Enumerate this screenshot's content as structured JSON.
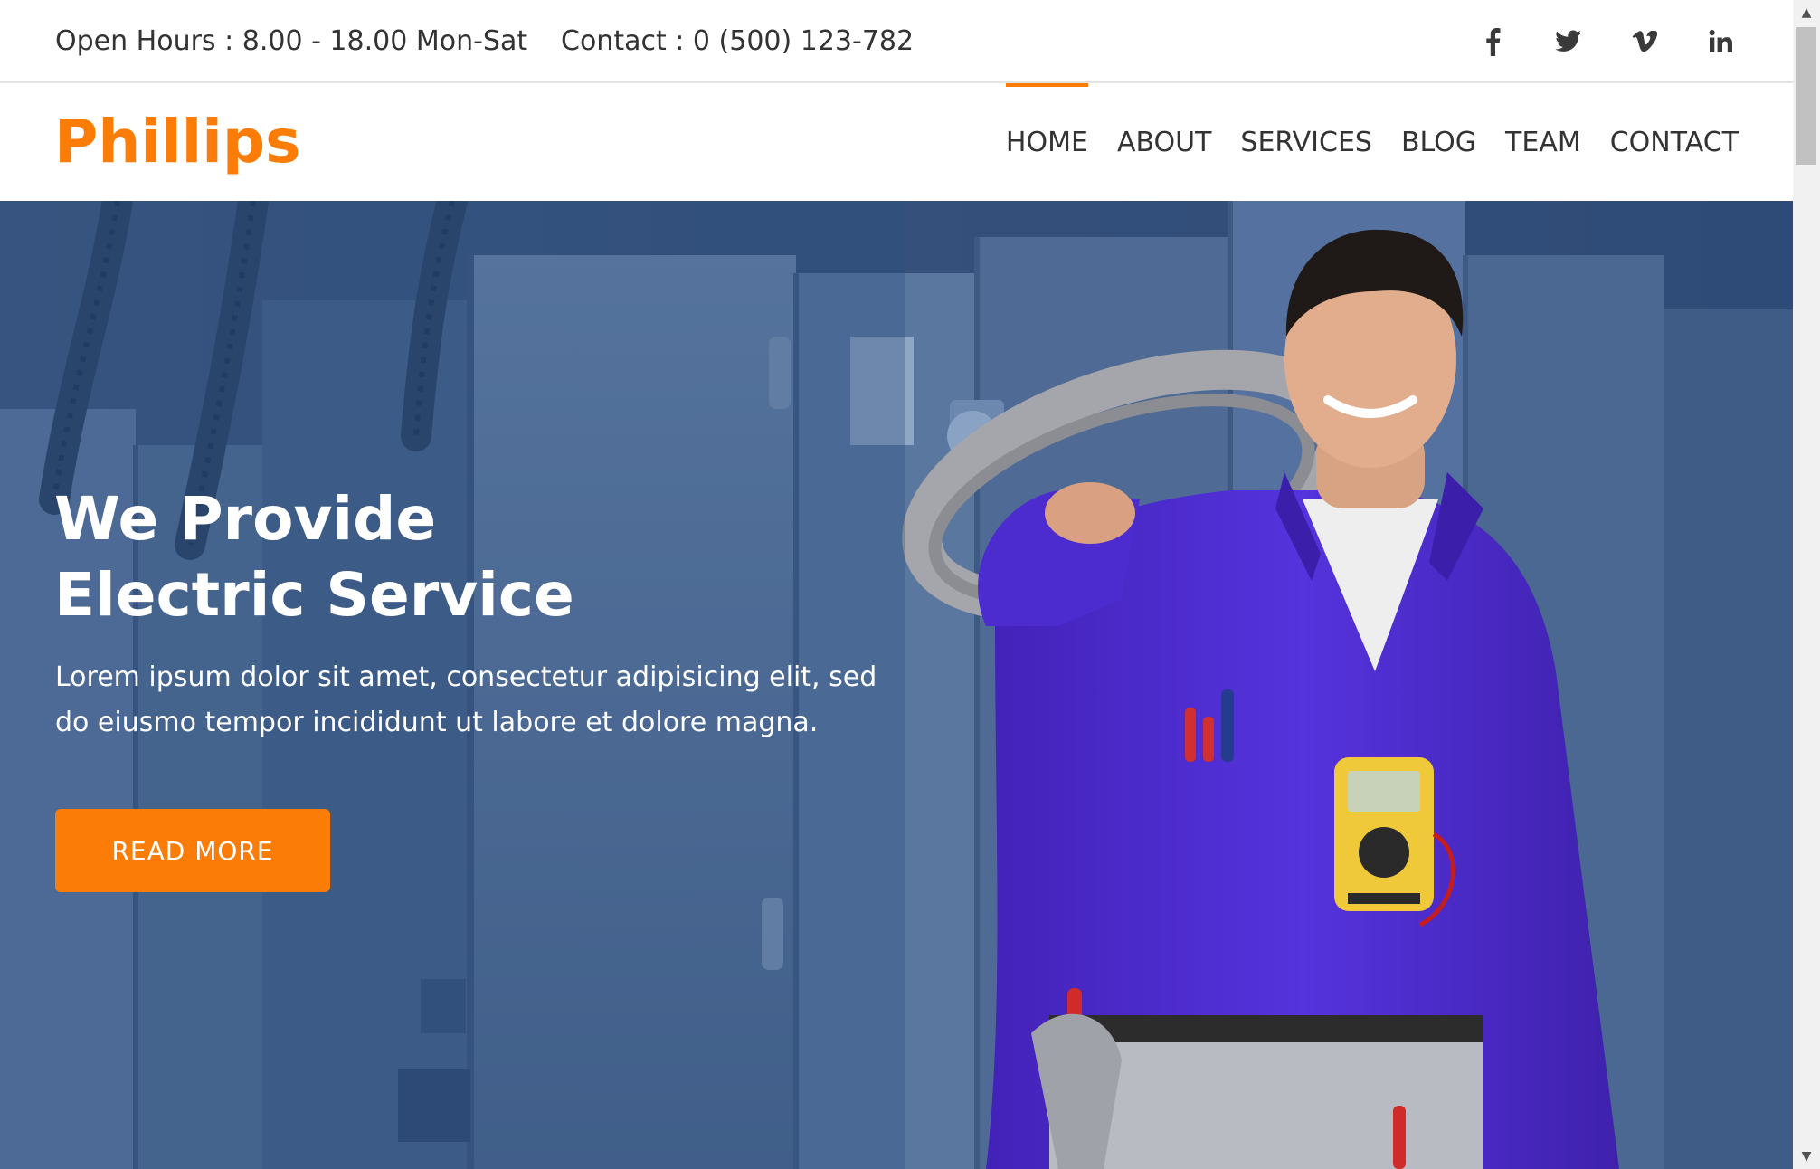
{
  "topbar": {
    "hours": "Open Hours : 8.00 - 18.00 Mon-Sat",
    "contact": "Contact : 0 (500) 123-782",
    "social": [
      "facebook-icon",
      "twitter-icon",
      "vimeo-icon",
      "linkedin-icon"
    ]
  },
  "brand": {
    "logo": "Phillips"
  },
  "nav": {
    "items": [
      {
        "label": "HOME",
        "active": true
      },
      {
        "label": "ABOUT",
        "active": false
      },
      {
        "label": "SERVICES",
        "active": false
      },
      {
        "label": "BLOG",
        "active": false
      },
      {
        "label": "TEAM",
        "active": false
      },
      {
        "label": "CONTACT",
        "active": false
      }
    ]
  },
  "hero": {
    "title_line1": "We Provide",
    "title_line2": "Electric Service",
    "text": "Lorem ipsum dolor sit amet, consectetur adipisicing elit, sed do eiusmo tempor incididunt ut labore et dolore magna.",
    "button": "READ MORE"
  },
  "colors": {
    "accent": "#fb7d07",
    "text_dark": "#333333",
    "hero_overlay": "#2f4f7e",
    "uniform": "#4f2ed4"
  }
}
